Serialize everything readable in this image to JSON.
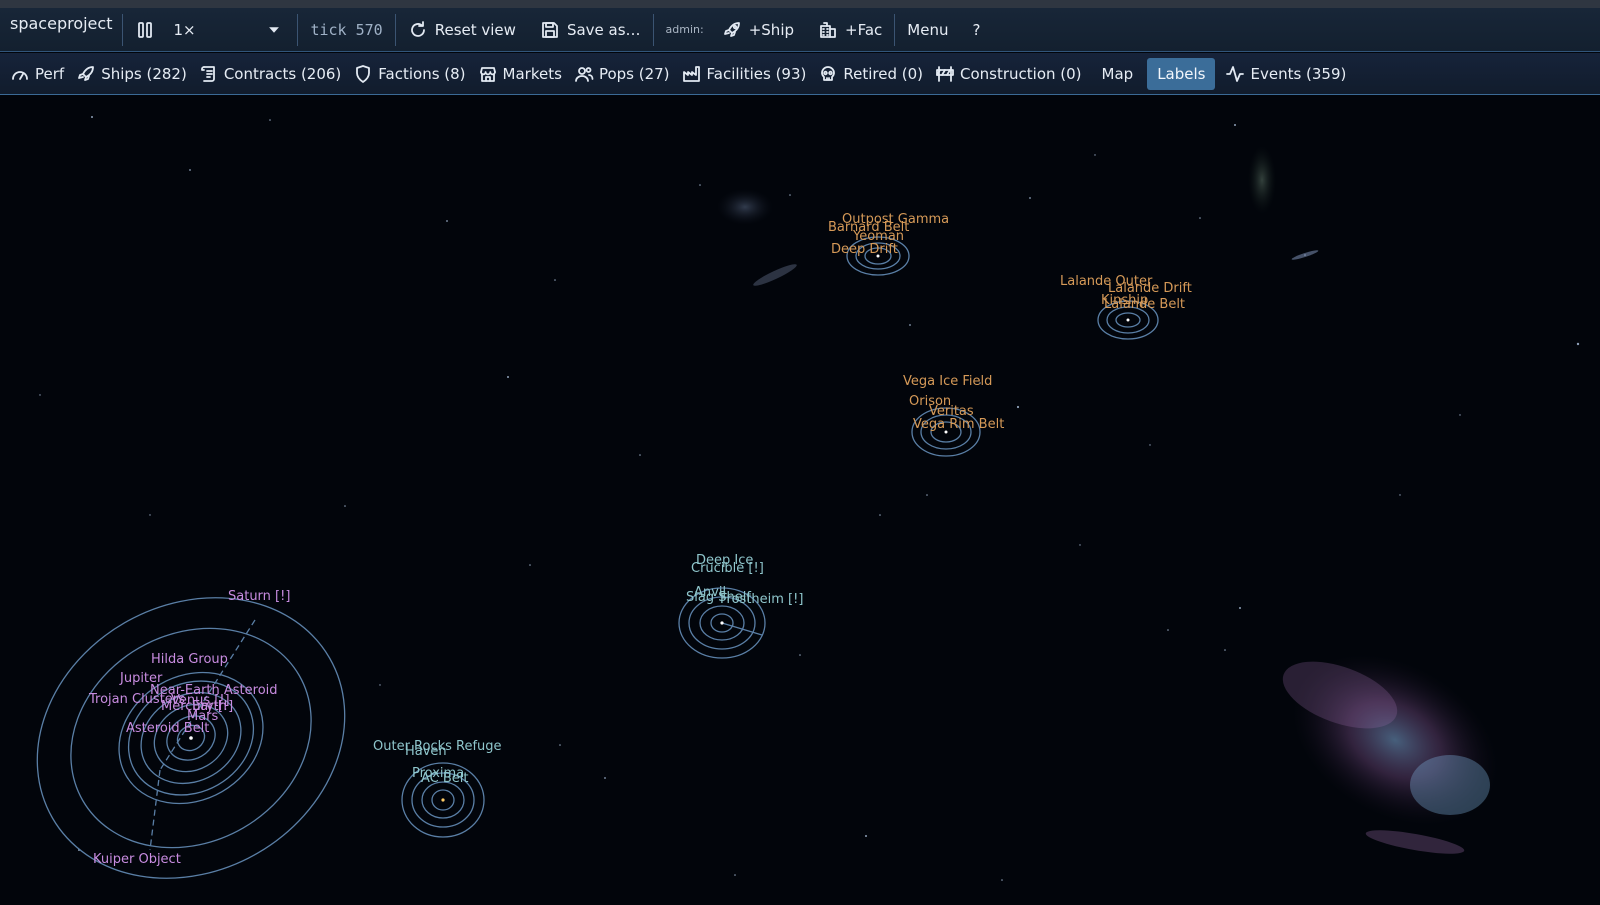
{
  "toolbar": {
    "app_title": "spaceproject",
    "speed_value": "1×",
    "tick": "tick 570",
    "reset_view": "Reset view",
    "save_as": "Save as…",
    "admin_label": "admin:",
    "add_ship": "+Ship",
    "add_fac": "+Fac",
    "menu": "Menu",
    "help": "?"
  },
  "nav": {
    "perf": "Perf",
    "ships": "Ships (282)",
    "contracts": "Contracts (206)",
    "factions": "Factions (8)",
    "markets": "Markets",
    "pops": "Pops (27)",
    "facilities": "Facilities (93)",
    "retired": "Retired (0)",
    "construction": "Construction (0)",
    "map": "Map",
    "labels": "Labels",
    "events": "Events (359)"
  },
  "map_labels": {
    "barnard": [
      "Outpost Gamma",
      "Barnard Belt",
      "Yeoman",
      "Deep Drift"
    ],
    "lalande": [
      "Lalande Outer",
      "Lalande Drift",
      "Kinship",
      "Lalande Belt"
    ],
    "vega": [
      "Vega Ice Field",
      "Orison",
      "Veritas",
      "Vega Rim Belt"
    ],
    "central": [
      "Deep Ice",
      "Crucible [!]",
      "Anvil",
      "Slag Shelf",
      "Frostheim [!]"
    ],
    "sol": [
      "Saturn [!]",
      "Hilda Group",
      "Jupiter",
      "Near-Earth Asteroid",
      "Trojan Clusters",
      "Mercury [!]",
      "Venus [!]",
      "Earth",
      "Mars",
      "Asteroid Belt",
      "Kuiper Object"
    ],
    "alpha": [
      "Outer Rocks Refuge",
      "Haven",
      "Proxima",
      "AC Belt"
    ]
  },
  "colors": {
    "background": "#02050b",
    "toolbar": "#182638",
    "accent_active": "#3b6d99",
    "orbit": "#5a7fa6",
    "label_orange": "#d69a58",
    "label_teal": "#8fc6cc",
    "label_purple": "#c88ce0"
  }
}
